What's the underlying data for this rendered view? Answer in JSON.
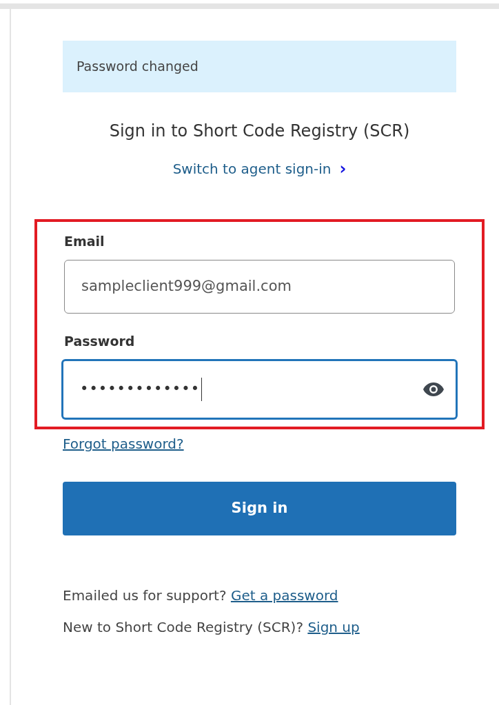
{
  "notice": {
    "text": "Password changed"
  },
  "title": "Sign in to Short Code Registry (SCR)",
  "agent_link": {
    "label": "Switch to agent sign-in",
    "icon": "›"
  },
  "highlighted": true,
  "fields": [
    {
      "kind": "email",
      "label": "Email",
      "value": "sampleclient999@gmail.com",
      "focused": false
    },
    {
      "kind": "password",
      "label": "Password",
      "value": "•••••••••••••",
      "focused": true
    }
  ],
  "forgot_link": "Forgot password?",
  "submit": "Sign in",
  "footer": [
    {
      "text": "Emailed us for support?",
      "link": "Get a password"
    },
    {
      "text": "New to Short Code Registry (SCR)?",
      "link": "Sign up"
    }
  ]
}
